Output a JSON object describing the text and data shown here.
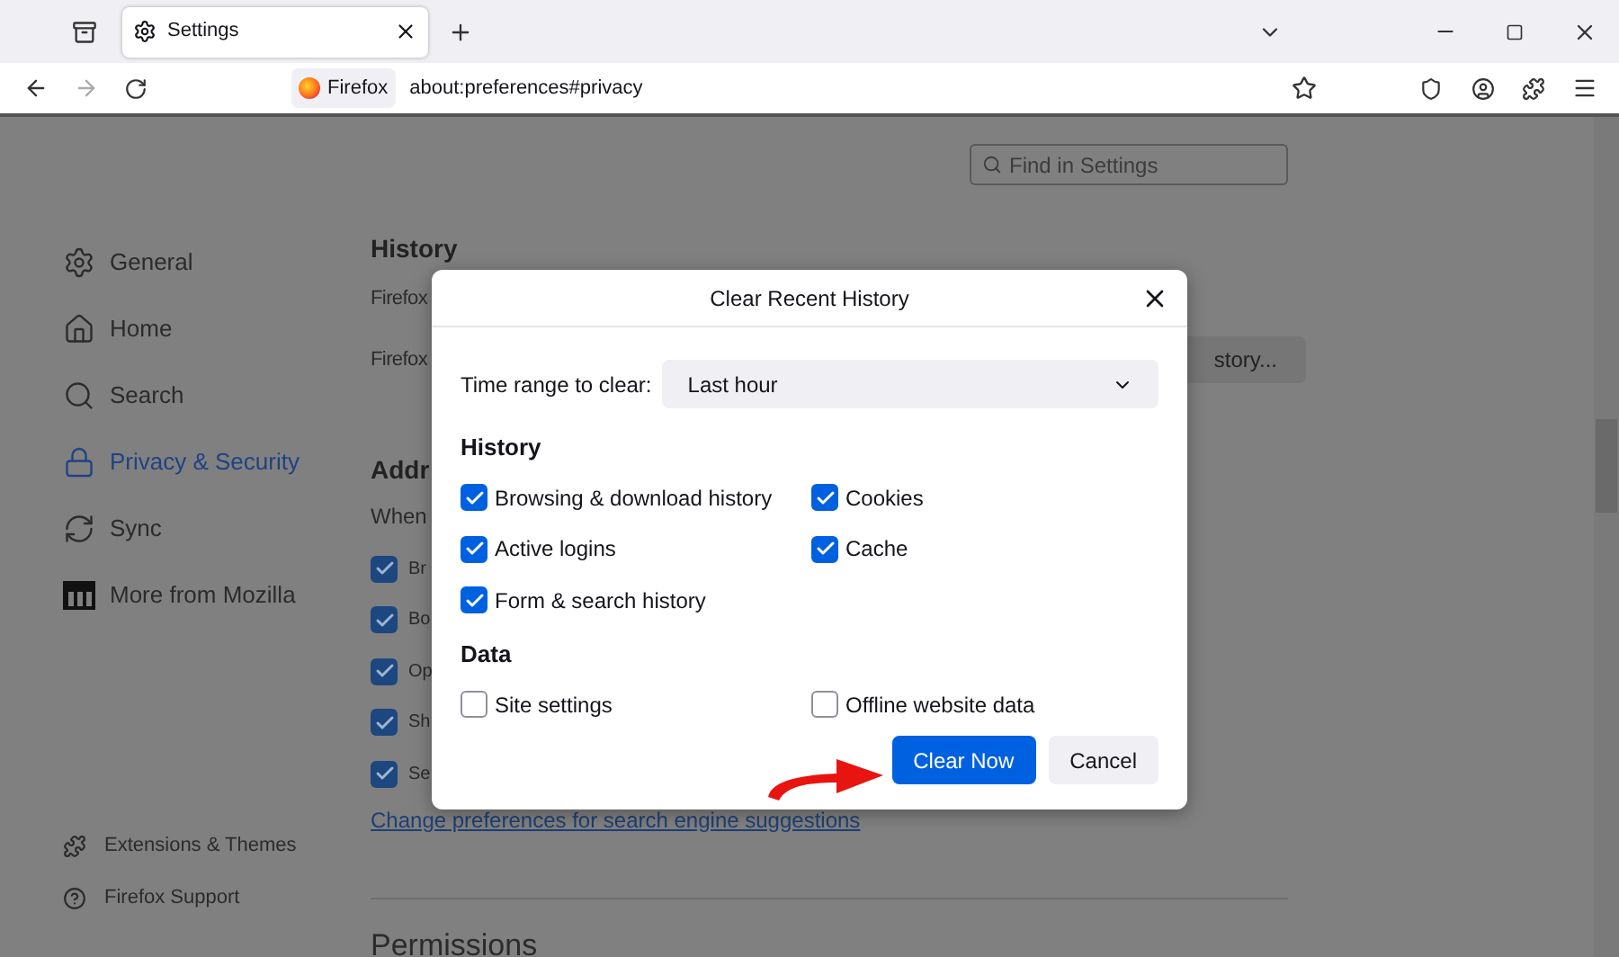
{
  "tabs": [
    {
      "title": "Settings",
      "selected": true
    }
  ],
  "address_bar": {
    "identity": "Firefox",
    "url": "about:preferences#privacy"
  },
  "search": {
    "placeholder": "Find in Settings"
  },
  "sidebar": {
    "items": [
      {
        "label": "General",
        "selected": false
      },
      {
        "label": "Home",
        "selected": false
      },
      {
        "label": "Search",
        "selected": false
      },
      {
        "label": "Privacy & Security",
        "selected": true
      },
      {
        "label": "Sync",
        "selected": false
      },
      {
        "label": "More from Mozilla",
        "selected": false
      }
    ],
    "footer": [
      "Extensions & Themes",
      "Firefox Support"
    ]
  },
  "main": {
    "history_heading": "History",
    "history_lines": [
      "Firefox",
      "Firefox"
    ],
    "history_button": "story...",
    "address_heading": "Addr",
    "address_text": "When",
    "address_options": [
      {
        "label": "Br",
        "checked": true
      },
      {
        "label": "Bo",
        "checked": true
      },
      {
        "label": "Op",
        "checked": true
      },
      {
        "label": "Sh",
        "checked": true
      },
      {
        "label": "Se",
        "checked": true
      }
    ],
    "link": "Change preferences for search engine suggestions",
    "next_heading": "Permissions"
  },
  "dialog": {
    "title": "Clear Recent History",
    "time_range_label": "Time range to clear:",
    "time_range_value": "Last hour",
    "sections": [
      {
        "heading": "History",
        "options": [
          {
            "label": "Browsing & download history",
            "checked": true
          },
          {
            "label": "Cookies",
            "checked": true
          },
          {
            "label": "Active logins",
            "checked": true
          },
          {
            "label": "Cache",
            "checked": true
          },
          {
            "label": "Form & search history",
            "checked": true
          }
        ]
      },
      {
        "heading": "Data",
        "options": [
          {
            "label": "Site settings",
            "checked": false
          },
          {
            "label": "Offline website data",
            "checked": false
          }
        ]
      }
    ],
    "buttons": [
      {
        "label": "Clear Now",
        "kind": "primary"
      },
      {
        "label": "Cancel",
        "kind": "secondary"
      }
    ]
  }
}
